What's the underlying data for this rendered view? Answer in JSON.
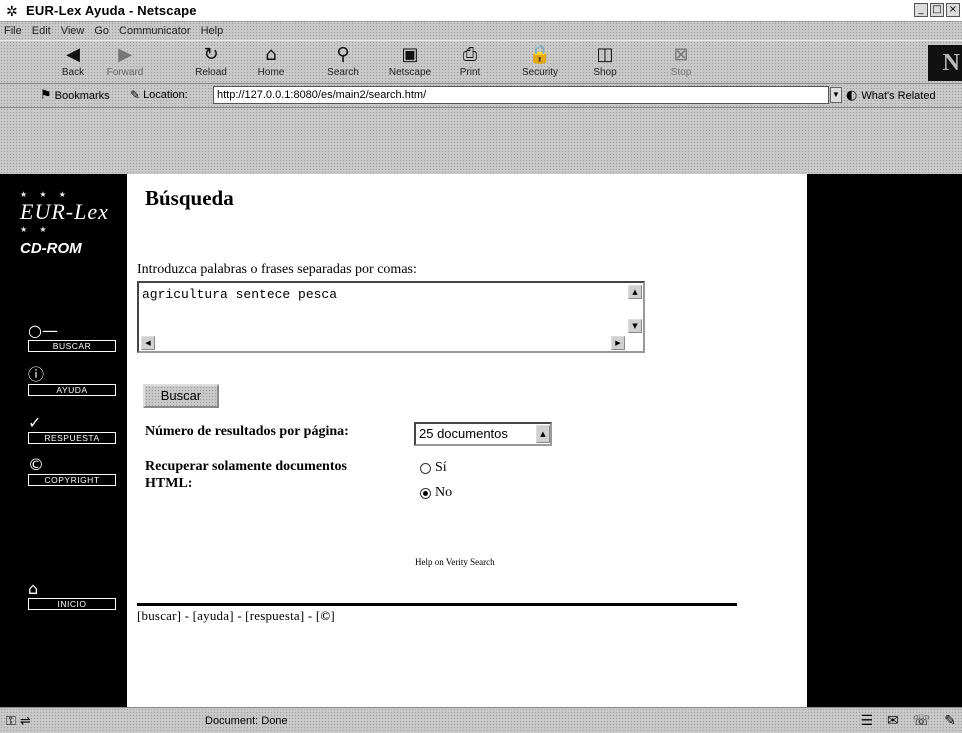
{
  "window": {
    "title": "EUR-Lex Ayuda - Netscape",
    "icon": "netscape-star-icon"
  },
  "menu": [
    "File",
    "Edit",
    "View",
    "Go",
    "Communicator",
    "Help"
  ],
  "toolbar": {
    "buttons": [
      {
        "label": "Back",
        "icon": "back-arrow-icon"
      },
      {
        "label": "Forward",
        "icon": "forward-arrow-icon"
      },
      {
        "label": "Reload",
        "icon": "reload-icon"
      },
      {
        "label": "Home",
        "icon": "home-icon"
      },
      {
        "label": "Search",
        "icon": "search-icon"
      },
      {
        "label": "Netscape",
        "icon": "netscape-icon"
      },
      {
        "label": "Print",
        "icon": "print-icon"
      },
      {
        "label": "Security",
        "icon": "lock-icon"
      },
      {
        "label": "Shop",
        "icon": "shop-icon"
      },
      {
        "label": "Stop",
        "icon": "stop-icon"
      }
    ],
    "brand": "N"
  },
  "location_bar": {
    "bookmarks_label": "Bookmarks",
    "location_label": "Location:",
    "url": "http://127.0.0.1:8080/es/main2/search.htm/",
    "whats_related": "What's Related"
  },
  "sidebar": {
    "logo_text": "EUR-Lex",
    "logo_subtitle": "CD-ROM",
    "nav": [
      {
        "label": "BUSCAR",
        "icon": "key-icon"
      },
      {
        "label": "AYUDA",
        "icon": "info-icon"
      },
      {
        "label": "RESPUESTA",
        "icon": "check-icon"
      },
      {
        "label": "COPYRIGHT",
        "icon": "copyright-icon"
      },
      {
        "label": "INICIO",
        "icon": "home-icon"
      }
    ]
  },
  "page": {
    "title": "Búsqueda",
    "query_label": "Introduzca palabras o frases separadas por comas:",
    "query_value": "agricultura sentece pesca",
    "search_button": "Buscar",
    "results_label": "Número de resultados por página:",
    "results_value": "25 documentos",
    "html_only_label": "Recuperar solamente documentos HTML:",
    "radio_yes": "Sí",
    "radio_no": "No",
    "radio_selected": "No",
    "verity_link": "Help on Verity Search",
    "footer": {
      "buscar": "buscar",
      "ayuda": "ayuda",
      "respuesta": "respuesta",
      "copyright": "©"
    }
  },
  "status": {
    "text": "Document: Done"
  }
}
